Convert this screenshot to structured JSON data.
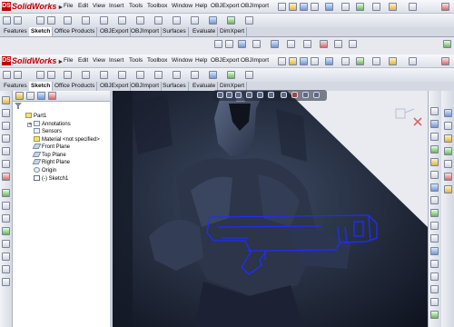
{
  "app": {
    "logo_text": "SolidWorks",
    "logo_arrow": "►",
    "brand_color": "#c00000"
  },
  "menu": {
    "items": [
      "File",
      "Edit",
      "View",
      "Insert",
      "Tools",
      "Toolbox",
      "Window",
      "Help",
      "OBJExport",
      "OBJImport"
    ]
  },
  "tabs": {
    "items": [
      "Features",
      "Sketch",
      "Office Products",
      "OBJExport",
      "OBJImport",
      "Surfaces",
      "Evaluate",
      "DimXpert"
    ],
    "active": "Sketch"
  },
  "feature_tree": {
    "root": "Part1",
    "items": [
      "Annotations",
      "Sensors",
      "Material <not specified>",
      "Front Plane",
      "Top Plane",
      "Right Plane",
      "Origin",
      "(-) Sketch1"
    ]
  },
  "icons": {
    "filter": "filter-icon",
    "view_tools": [
      "zoom-fit-icon",
      "zoom-area-icon",
      "previous-view-icon",
      "section-view-icon",
      "view-orientation-icon",
      "display-style-icon",
      "hide-show-icon",
      "edit-appearance-icon",
      "scene-icon",
      "view-settings-icon"
    ]
  },
  "graphics": {
    "sketch_line_color": "#1f2cff",
    "background_image": "dark scene with armored figure holding blaster"
  }
}
